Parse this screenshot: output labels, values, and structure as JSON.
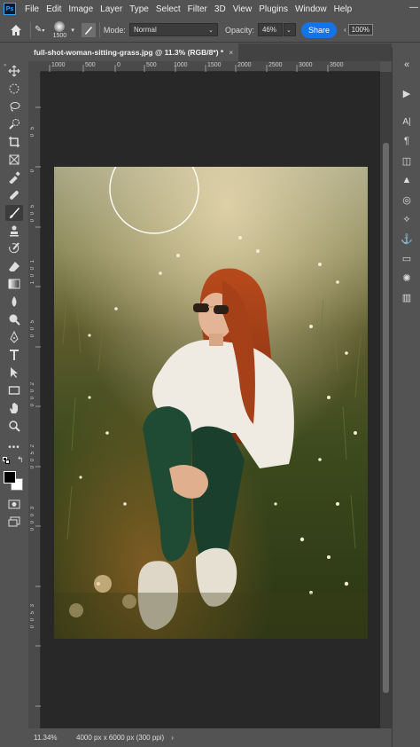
{
  "app": {
    "logo_text": "Ps"
  },
  "menu": [
    "File",
    "Edit",
    "Image",
    "Layer",
    "Type",
    "Select",
    "Filter",
    "3D",
    "View",
    "Plugins",
    "Window",
    "Help"
  ],
  "options": {
    "brush_size": "1500",
    "mode_label": "Mode:",
    "mode_value": "Normal",
    "opacity_label": "Opacity:",
    "opacity_value": "46%",
    "share_label": "Share",
    "zoom_value": "100%"
  },
  "document": {
    "tab_title": "full-shot-woman-sitting-grass.jpg @ 11.3% (RGB/8*) *",
    "close_glyph": "×"
  },
  "ruler_top_labels": [
    "1000",
    "500",
    "0",
    "500",
    "1000",
    "1500",
    "2000",
    "2500",
    "3000",
    "3500"
  ],
  "ruler_left_labels": [
    "5",
    "0",
    "5",
    "0",
    "0",
    "5",
    "0",
    "0",
    "1",
    "0",
    "0",
    "1",
    "5",
    "0",
    "0",
    "2",
    "0",
    "0",
    "0",
    "2",
    "5",
    "0",
    "0",
    "3",
    "0",
    "0",
    "0",
    "3",
    "5",
    "0",
    "0"
  ],
  "tools": [
    "move-tool-icon",
    "marquee-tool-icon",
    "lasso-tool-icon",
    "quick-select-tool-icon",
    "crop-tool-icon",
    "frame-tool-icon",
    "eyedropper-tool-icon",
    "healing-brush-icon",
    "brush-tool-icon",
    "clone-stamp-icon",
    "history-brush-icon",
    "eraser-tool-icon",
    "gradient-tool-icon",
    "blur-tool-icon",
    "dodge-tool-icon",
    "pen-tool-icon",
    "type-tool-icon",
    "path-select-icon",
    "rectangle-tool-icon",
    "hand-tool-icon",
    "zoom-tool-icon",
    "more-tools-icon"
  ],
  "colors": {
    "foreground": "#000000",
    "background": "#ffffff",
    "accent": "#1473e6"
  },
  "status": {
    "zoom": "11.34%",
    "doc_info": "4000 px x 6000 px (300 ppi)",
    "arrow": "›"
  }
}
